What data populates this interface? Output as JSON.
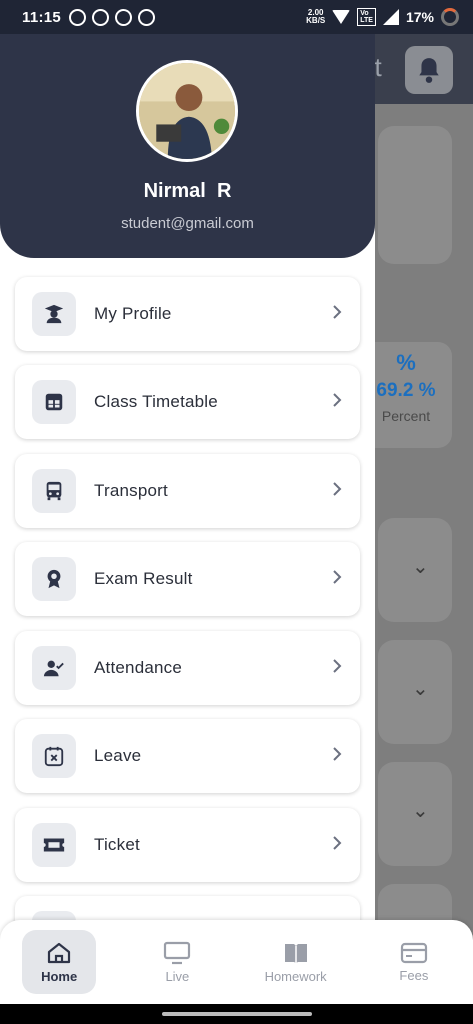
{
  "status_bar": {
    "time": "11:15",
    "speed_top": "2.00",
    "speed_unit": "KB/S",
    "battery": "17%"
  },
  "background": {
    "header_partial": "nt",
    "percent_symbol": "%",
    "percent_value": "69.2 %",
    "percent_label": "Percent"
  },
  "profile": {
    "name": "Nirmal  R",
    "email": "student@gmail.com"
  },
  "menu": [
    {
      "label": "My Profile",
      "icon": "student-icon"
    },
    {
      "label": "Class Timetable",
      "icon": "timetable-icon"
    },
    {
      "label": "Transport",
      "icon": "bus-icon"
    },
    {
      "label": "Exam Result",
      "icon": "award-icon"
    },
    {
      "label": "Attendance",
      "icon": "user-check-icon"
    },
    {
      "label": "Leave",
      "icon": "calendar-x-icon"
    },
    {
      "label": "Ticket",
      "icon": "ticket-icon"
    }
  ],
  "bottom_nav": [
    {
      "label": "Home",
      "icon": "home-icon",
      "active": true
    },
    {
      "label": "Live",
      "icon": "monitor-icon"
    },
    {
      "label": "Homework",
      "icon": "book-icon"
    },
    {
      "label": "Fees",
      "icon": "card-icon"
    }
  ],
  "colors": {
    "drawer_header": "#2e3448",
    "accent": "#1c6fbf"
  }
}
